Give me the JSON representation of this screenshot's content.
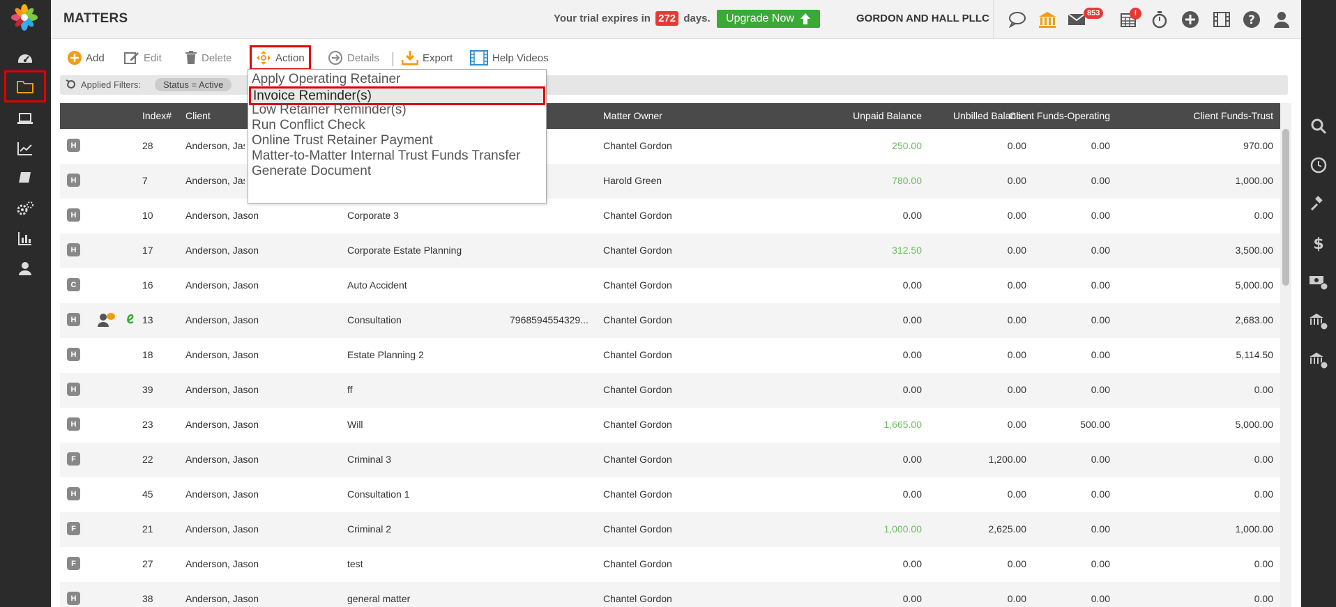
{
  "app": {
    "title": "MATTERS"
  },
  "trial": {
    "prefix": "Your trial expires in",
    "days": "272",
    "suffix": "days."
  },
  "upgrade_label": "Upgrade Now",
  "firm_name": "GORDON AND HALL PLLC",
  "badges": {
    "mail": "853",
    "calendar": "!"
  },
  "toolbar": {
    "add": "Add",
    "edit": "Edit",
    "delete": "Delete",
    "action": "Action",
    "details": "Details",
    "export": "Export",
    "help_videos": "Help Videos"
  },
  "filters": {
    "label": "Applied Filters:",
    "chip": "Status = Active"
  },
  "columns": {
    "index": "Index#",
    "client": "Client",
    "owner": "Matter Owner",
    "unpaid": "Unpaid Balance",
    "unbilled": "Unbilled Balance",
    "operating": "Client Funds-Operating",
    "trust": "Client Funds-Trust"
  },
  "rows": [
    {
      "tag": "H",
      "index": "28",
      "client": "Anderson, Jason",
      "matter": "",
      "ref": "",
      "owner": "Chantel Gordon",
      "unpaid": "250.00",
      "unbilled": "0.00",
      "operating": "0.00",
      "trust": "970.00"
    },
    {
      "tag": "H",
      "index": "7",
      "client": "Anderson, Jason",
      "matter": "",
      "ref": "",
      "owner": "Harold Green",
      "unpaid": "780.00",
      "unbilled": "0.00",
      "operating": "0.00",
      "trust": "1,000.00"
    },
    {
      "tag": "H",
      "index": "10",
      "client": "Anderson, Jason",
      "matter": "Corporate 3",
      "ref": "",
      "owner": "Chantel Gordon",
      "unpaid": "0.00",
      "unbilled": "0.00",
      "operating": "0.00",
      "trust": "0.00"
    },
    {
      "tag": "H",
      "index": "17",
      "client": "Anderson, Jason",
      "matter": "Corporate Estate Planning",
      "ref": "",
      "owner": "Chantel Gordon",
      "unpaid": "312.50",
      "unbilled": "0.00",
      "operating": "0.00",
      "trust": "3,500.00"
    },
    {
      "tag": "C",
      "index": "16",
      "client": "Anderson, Jason",
      "matter": "Auto Accident",
      "ref": "",
      "owner": "Chantel Gordon",
      "unpaid": "0.00",
      "unbilled": "0.00",
      "operating": "0.00",
      "trust": "5,000.00"
    },
    {
      "tag": "H",
      "index": "13",
      "client": "Anderson, Jason",
      "matter": "Consultation",
      "ref": "7968594554329...",
      "owner": "Chantel Gordon",
      "unpaid": "0.00",
      "unbilled": "0.00",
      "operating": "0.00",
      "trust": "2,683.00"
    },
    {
      "tag": "H",
      "index": "18",
      "client": "Anderson, Jason",
      "matter": "Estate Planning 2",
      "ref": "",
      "owner": "Chantel Gordon",
      "unpaid": "0.00",
      "unbilled": "0.00",
      "operating": "0.00",
      "trust": "5,114.50"
    },
    {
      "tag": "H",
      "index": "39",
      "client": "Anderson, Jason",
      "matter": "ff",
      "ref": "",
      "owner": "Chantel Gordon",
      "unpaid": "0.00",
      "unbilled": "0.00",
      "operating": "0.00",
      "trust": "0.00"
    },
    {
      "tag": "H",
      "index": "23",
      "client": "Anderson, Jason",
      "matter": "Will",
      "ref": "",
      "owner": "Chantel Gordon",
      "unpaid": "1,665.00",
      "unbilled": "0.00",
      "operating": "500.00",
      "trust": "5,000.00"
    },
    {
      "tag": "F",
      "index": "22",
      "client": "Anderson, Jason",
      "matter": "Criminal 3",
      "ref": "",
      "owner": "Chantel Gordon",
      "unpaid": "0.00",
      "unbilled": "1,200.00",
      "operating": "0.00",
      "trust": "0.00"
    },
    {
      "tag": "H",
      "index": "45",
      "client": "Anderson, Jason",
      "matter": "Consultation 1",
      "ref": "",
      "owner": "Chantel Gordon",
      "unpaid": "0.00",
      "unbilled": "0.00",
      "operating": "0.00",
      "trust": "0.00"
    },
    {
      "tag": "F",
      "index": "21",
      "client": "Anderson, Jason",
      "matter": "Criminal 2",
      "ref": "",
      "owner": "Chantel Gordon",
      "unpaid": "1,000.00",
      "unbilled": "2,625.00",
      "operating": "0.00",
      "trust": "1,000.00"
    },
    {
      "tag": "F",
      "index": "27",
      "client": "Anderson, Jason",
      "matter": "test",
      "ref": "",
      "owner": "Chantel Gordon",
      "unpaid": "0.00",
      "unbilled": "0.00",
      "operating": "0.00",
      "trust": "0.00"
    },
    {
      "tag": "H",
      "index": "38",
      "client": "Anderson, Jason",
      "matter": "general matter",
      "ref": "",
      "owner": "Chantel Gordon",
      "unpaid": "0.00",
      "unbilled": "0.00",
      "operating": "0.00",
      "trust": "0.00"
    }
  ],
  "action_menu": {
    "items": [
      "Apply Operating Retainer",
      "Invoice Reminder(s)",
      "Low Retainer Reminder(s)",
      "Run Conflict Check",
      "Online Trust Retainer Payment",
      "Matter-to-Matter Internal Trust Funds Transfer",
      "Generate Document"
    ],
    "highlighted": 1
  },
  "colors": {
    "accent_orange": "#f39c12",
    "upgrade_green": "#3aaa35",
    "alert_red": "#e53935",
    "positive_green": "#6bbf5f"
  }
}
